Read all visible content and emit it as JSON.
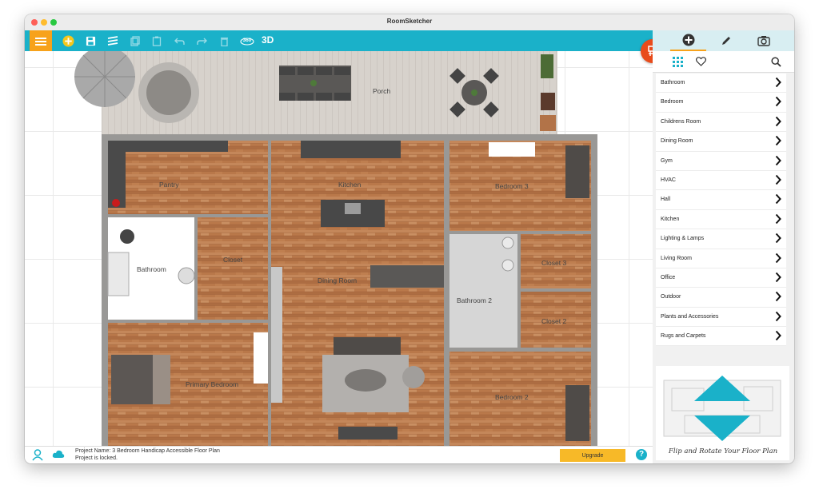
{
  "window": {
    "title": "RoomSketcher"
  },
  "toolbar": {
    "mode_3d": "3D",
    "rotate_icon": "360"
  },
  "floorplan": {
    "rooms": {
      "porch": "Porch",
      "pantry": "Pantry",
      "kitchen": "Kitchen",
      "bedroom3": "Bedroom 3",
      "bathroom": "Bathroom",
      "closet": "Closet",
      "dining": "Dining Room",
      "bathroom2": "Bathroom 2",
      "closet3": "Closet 3",
      "closet2": "Closet 2",
      "primary": "Primary Bedroom",
      "bedroom2": "Bedroom 2"
    }
  },
  "status": {
    "project_name": "Project Name: 3 Bedroom Handicap Accessible Floor Plan",
    "locked": "Project is locked.",
    "upgrade": "Upgrade",
    "help": "?"
  },
  "panel": {
    "categories": [
      {
        "label": "Bathroom"
      },
      {
        "label": "Bedroom"
      },
      {
        "label": "Childrens Room"
      },
      {
        "label": "Dining Room"
      },
      {
        "label": "Gym"
      },
      {
        "label": "HVAC"
      },
      {
        "label": "Hall"
      },
      {
        "label": "Kitchen"
      },
      {
        "label": "Lighting & Lamps"
      },
      {
        "label": "Living Room"
      },
      {
        "label": "Office"
      },
      {
        "label": "Outdoor"
      },
      {
        "label": "Plants and Accessories"
      },
      {
        "label": "Rugs and Carpets"
      }
    ],
    "promo_caption": "Flip and Rotate Your Floor Plan"
  },
  "colors": {
    "accent": "#1ab1c9",
    "menu": "#f7a21b",
    "fab": "#e84b1b",
    "promo_arrow": "#1ab1c9"
  },
  "icons": [
    "menu-icon",
    "add-icon",
    "save-icon",
    "layers-icon",
    "copy-icon",
    "paste-icon",
    "undo-icon",
    "redo-icon",
    "delete-icon",
    "rotate-360-icon",
    "furniture-icon",
    "plus-icon",
    "pencil-icon",
    "camera-icon",
    "grid-icon",
    "heart-icon",
    "search-icon",
    "chevron-right-icon",
    "user-icon",
    "cloud-icon",
    "expand-icon"
  ]
}
